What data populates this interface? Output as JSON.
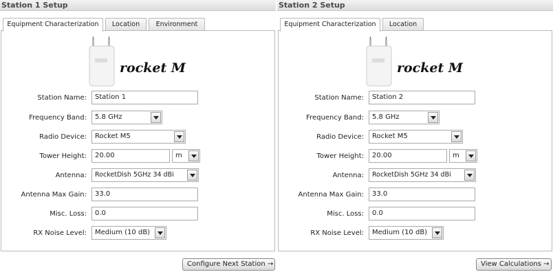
{
  "station1": {
    "title": "Station 1 Setup",
    "tabs": [
      "Equipment Characterization",
      "Location",
      "Environment"
    ],
    "brand": "rocket M",
    "fields": {
      "station_name": {
        "label": "Station Name:",
        "value": "Station 1"
      },
      "frequency_band": {
        "label": "Frequency Band:",
        "value": "5.8 GHz"
      },
      "radio_device": {
        "label": "Radio Device:",
        "value": "Rocket M5"
      },
      "tower_height": {
        "label": "Tower Height:",
        "value": "20.00",
        "unit": "m"
      },
      "antenna": {
        "label": "Antenna:",
        "value": "RocketDish 5GHz 34 dBi"
      },
      "antenna_max_gain": {
        "label": "Antenna Max Gain:",
        "value": "33.0"
      },
      "misc_loss": {
        "label": "Misc. Loss:",
        "value": "0.0"
      },
      "rx_noise_level": {
        "label": "RX Noise Level:",
        "value": "Medium (10 dB)"
      }
    },
    "button": "Configure Next Station →"
  },
  "station2": {
    "title": "Station 2 Setup",
    "tabs": [
      "Equipment Characterization",
      "Location"
    ],
    "brand": "rocket M",
    "fields": {
      "station_name": {
        "label": "Station Name:",
        "value": "Station 2"
      },
      "frequency_band": {
        "label": "Frequency Band:",
        "value": "5.8 GHz"
      },
      "radio_device": {
        "label": "Radio Device:",
        "value": "Rocket M5"
      },
      "tower_height": {
        "label": "Tower Height:",
        "value": "20.00",
        "unit": "m"
      },
      "antenna": {
        "label": "Antenna:",
        "value": "RocketDish 5GHz 34 dBi"
      },
      "antenna_max_gain": {
        "label": "Antenna Max Gain:",
        "value": "33.0"
      },
      "misc_loss": {
        "label": "Misc. Loss:",
        "value": "0.0"
      },
      "rx_noise_level": {
        "label": "RX Noise Level:",
        "value": "Medium (10 dB)"
      }
    },
    "button": "View Calculations →"
  },
  "icons": {
    "device": "rocket-m-device-icon",
    "dropdown": "chevron-down-icon"
  }
}
